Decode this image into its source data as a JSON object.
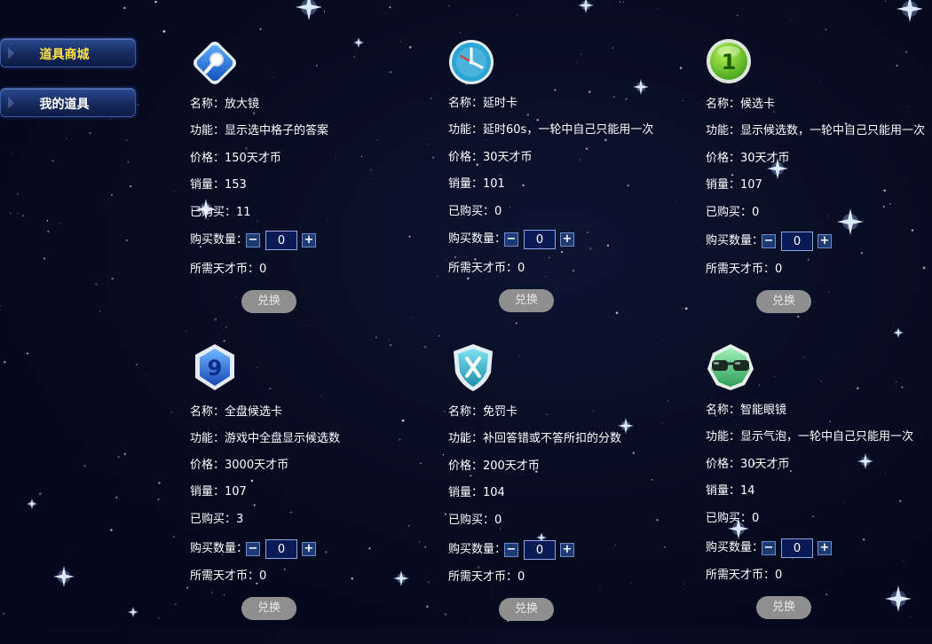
{
  "sidebar": {
    "items": [
      {
        "label": "道具商城",
        "active": true
      },
      {
        "label": "我的道具",
        "active": false
      }
    ]
  },
  "labels": {
    "name": "名称：",
    "function": "功能：",
    "price": "价格：",
    "sales": "销量：",
    "purchased": "已购买：",
    "quantity": "购买数量：",
    "required": "所需天才币：",
    "exchange": "兑换",
    "minus": "−",
    "plus": "+"
  },
  "colors": {
    "active_label": "#ffe14a",
    "exchange_button": "#8f8f8f"
  },
  "items": [
    {
      "icon": "magnifier-icon",
      "name": "放大镜",
      "function": "显示选中格子的答案",
      "price": "150天才币",
      "sales": "153",
      "purchased": "11",
      "quantity": "0",
      "required": "0"
    },
    {
      "icon": "clock-icon",
      "name": "延时卡",
      "function": "延时60s，一轮中自己只能用一次",
      "price": "30天才币",
      "sales": "101",
      "purchased": "0",
      "quantity": "0",
      "required": "0"
    },
    {
      "icon": "number-one-badge-icon",
      "name": "候选卡",
      "function": "显示候选数，一轮中自己只能用一次",
      "price": "30天才币",
      "sales": "107",
      "purchased": "0",
      "quantity": "0",
      "required": "0"
    },
    {
      "icon": "number-nine-shield-icon",
      "name": "全盘候选卡",
      "function": "游戏中全盘显示候选数",
      "price": "3000天才币",
      "sales": "107",
      "purchased": "3",
      "quantity": "0",
      "required": "0"
    },
    {
      "icon": "x-shield-icon",
      "name": "免罚卡",
      "function": "补回答错或不答所扣的分数",
      "price": "200天才币",
      "sales": "104",
      "purchased": "0",
      "quantity": "0",
      "required": "0"
    },
    {
      "icon": "glasses-icon",
      "name": "智能眼镜",
      "function": "显示气泡，一轮中自己只能用一次",
      "price": "30天才币",
      "sales": "14",
      "purchased": "0",
      "quantity": "0",
      "required": "0"
    }
  ]
}
